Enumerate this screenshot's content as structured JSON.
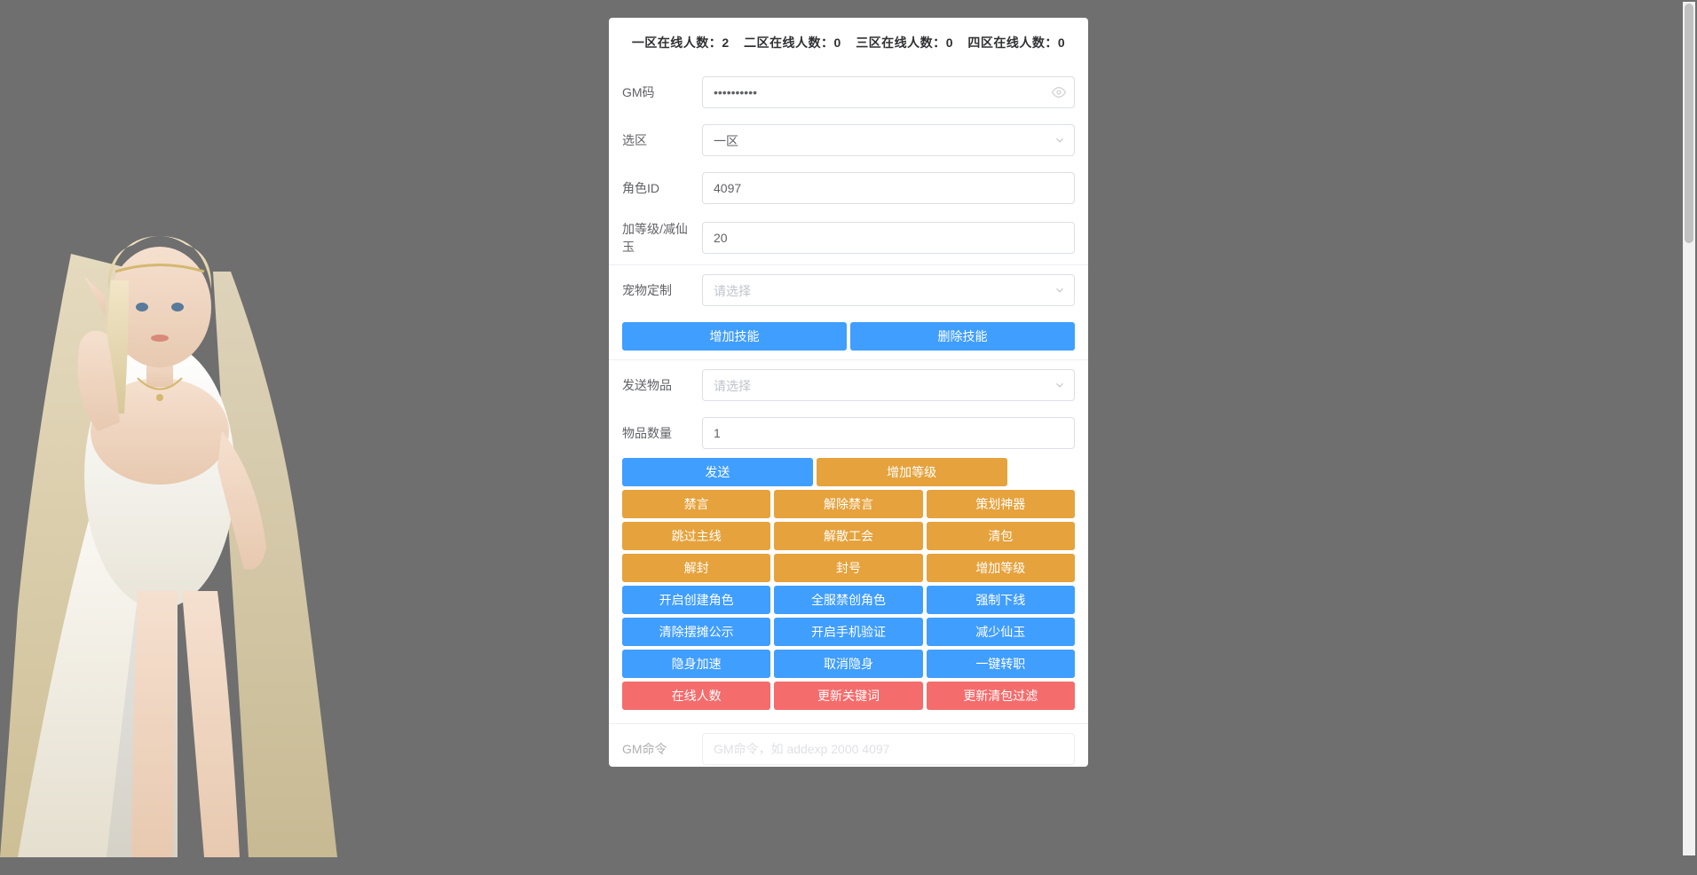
{
  "stats": {
    "zones": [
      {
        "label": "一区在线人数：",
        "value": "2"
      },
      {
        "label": "二区在线人数：",
        "value": "0"
      },
      {
        "label": "三区在线人数：",
        "value": "0"
      },
      {
        "label": "四区在线人数：",
        "value": "0"
      }
    ]
  },
  "form": {
    "gm_code": {
      "label": "GM码",
      "value": "••••••••••"
    },
    "zone_select": {
      "label": "选区",
      "value": "一区"
    },
    "role_id": {
      "label": "角色ID",
      "value": "4097"
    },
    "level_jade": {
      "label": "加等级/减仙玉",
      "value": "20"
    },
    "pet_custom": {
      "label": "宠物定制",
      "placeholder": "请选择"
    },
    "send_item": {
      "label": "发送物品",
      "placeholder": "请选择"
    },
    "item_count": {
      "label": "物品数量",
      "value": "1"
    },
    "gm_command": {
      "label": "GM命令",
      "placeholder": "GM命令，如 addexp 2000 4097"
    }
  },
  "skill_buttons": {
    "add": "增加技能",
    "remove": "删除技能"
  },
  "action_rows": [
    {
      "style": "mix-primary-warning",
      "buttons": [
        {
          "label": "发送",
          "variant": "primary"
        },
        {
          "label": "增加等级",
          "variant": "warning"
        }
      ]
    },
    {
      "style": "warning",
      "buttons": [
        {
          "label": "禁言",
          "variant": "warning"
        },
        {
          "label": "解除禁言",
          "variant": "warning"
        },
        {
          "label": "策划神器",
          "variant": "warning"
        }
      ]
    },
    {
      "style": "warning",
      "buttons": [
        {
          "label": "跳过主线",
          "variant": "warning"
        },
        {
          "label": "解散工会",
          "variant": "warning"
        },
        {
          "label": "清包",
          "variant": "warning"
        }
      ]
    },
    {
      "style": "warning",
      "buttons": [
        {
          "label": "解封",
          "variant": "warning"
        },
        {
          "label": "封号",
          "variant": "warning"
        },
        {
          "label": "增加等级",
          "variant": "warning"
        }
      ]
    },
    {
      "style": "primary",
      "buttons": [
        {
          "label": "开启创建角色",
          "variant": "primary"
        },
        {
          "label": "全服禁创角色",
          "variant": "primary"
        },
        {
          "label": "强制下线",
          "variant": "primary"
        }
      ]
    },
    {
      "style": "primary",
      "buttons": [
        {
          "label": "清除摆摊公示",
          "variant": "primary"
        },
        {
          "label": "开启手机验证",
          "variant": "primary"
        },
        {
          "label": "减少仙玉",
          "variant": "primary"
        }
      ]
    },
    {
      "style": "primary",
      "buttons": [
        {
          "label": "隐身加速",
          "variant": "primary"
        },
        {
          "label": "取消隐身",
          "variant": "primary"
        },
        {
          "label": "一键转职",
          "variant": "primary"
        }
      ]
    },
    {
      "style": "danger",
      "buttons": [
        {
          "label": "在线人数",
          "variant": "danger"
        },
        {
          "label": "更新关键词",
          "variant": "danger"
        },
        {
          "label": "更新清包过滤",
          "variant": "danger"
        }
      ]
    }
  ]
}
